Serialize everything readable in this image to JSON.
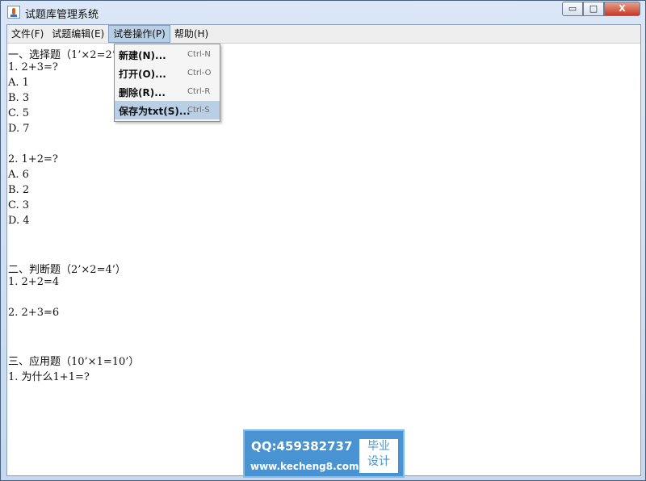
{
  "window": {
    "title": "试题库管理系统",
    "controls": {
      "minimize": "▭",
      "maximize": "□",
      "close": "X"
    }
  },
  "menubar": [
    {
      "label": "文件(F)"
    },
    {
      "label": "试题编辑(E)"
    },
    {
      "label": "试卷操作(P)"
    },
    {
      "label": "帮助(H)"
    }
  ],
  "dropdown": {
    "items": [
      {
        "label": "新建(N)...",
        "shortcut": "Ctrl-N"
      },
      {
        "label": "打开(O)...",
        "shortcut": "Ctrl-O"
      },
      {
        "label": "删除(R)...",
        "shortcut": "Ctrl-R"
      },
      {
        "label": "保存为txt(S)...",
        "shortcut": "Ctrl-S"
      }
    ]
  },
  "document": {
    "lines": [
      "一、选择题（1’×2=2’）",
      "1. 2+3=?",
      "A. 1",
      "B. 3",
      "C. 5",
      "D. 7",
      "",
      "2. 1+2=?",
      "A. 6",
      "B. 2",
      "C. 3",
      "D. 4",
      "",
      "",
      "二、判断题（2’×2=4’）",
      "1. 2+2=4",
      "",
      "2. 2+3=6",
      "",
      "",
      "三、应用题（10’×1=10’）",
      "1. 为什么1+1=?"
    ]
  },
  "watermark": {
    "qq": "QQ:459382737",
    "url": "www.kecheng8.com",
    "tag_line1": "毕业",
    "tag_line2": "设计"
  }
}
